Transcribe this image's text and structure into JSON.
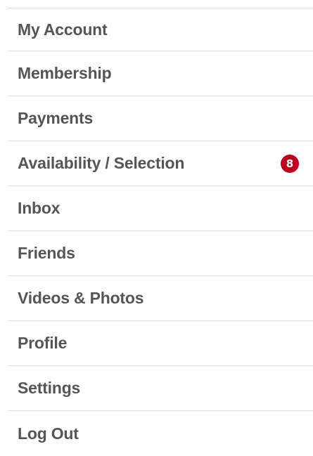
{
  "menu": {
    "items": [
      {
        "label": "My Account"
      },
      {
        "label": "Membership"
      },
      {
        "label": "Payments"
      },
      {
        "label": "Availability / Selection",
        "badge": "8"
      },
      {
        "label": "Inbox"
      },
      {
        "label": "Friends"
      },
      {
        "label": "Videos & Photos"
      },
      {
        "label": "Profile"
      },
      {
        "label": "Settings"
      },
      {
        "label": "Log Out"
      }
    ]
  },
  "colors": {
    "text": "#555555",
    "divider": "#dddddd",
    "badge_bg": "#c00020",
    "badge_text": "#ffffff"
  }
}
